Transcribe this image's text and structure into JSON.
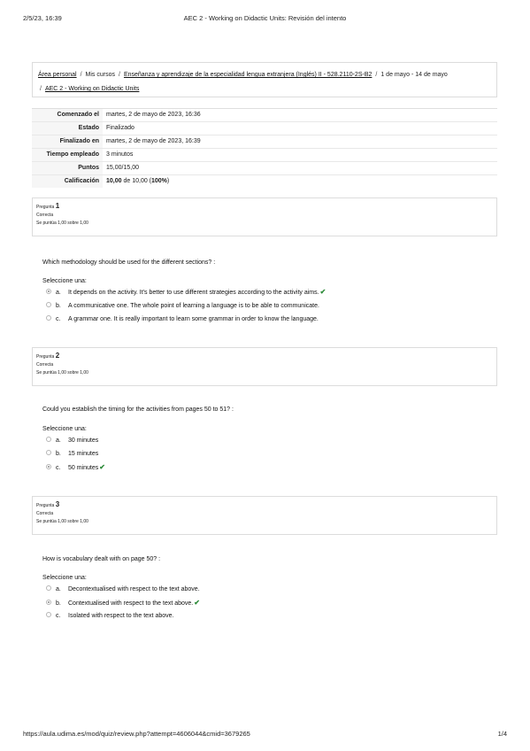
{
  "header": {
    "datetime": "2/5/23, 16:39",
    "title": "AEC 2 - Working on Didactic Units: Revisión del intento"
  },
  "breadcrumb": {
    "items": [
      "Área personal",
      "Mis cursos",
      "Enseñanza y aprendizaje de la especialidad lengua extranjera (Inglés) II - 528.2110-2S-B2",
      "1 de mayo - 14 de mayo",
      "AEC 2 - Working on Didactic Units"
    ],
    "separator": "/"
  },
  "summary": [
    {
      "label": "Comenzado el",
      "value": "martes, 2 de mayo de 2023, 16:36"
    },
    {
      "label": "Estado",
      "value": "Finalizado"
    },
    {
      "label": "Finalizado en",
      "value": "martes, 2 de mayo de 2023, 16:39"
    },
    {
      "label": "Tiempo empleado",
      "value": "3 minutos"
    },
    {
      "label": "Puntos",
      "value": "15,00/15,00"
    },
    {
      "label": "Calificación",
      "value_bold": "10,00",
      "value_mid": " de 10,00 (",
      "value_pct": "100%",
      "value_end": ")"
    }
  ],
  "questions": [
    {
      "prefix": "Pregunta",
      "number": "1",
      "status": "Correcta",
      "score": "Se puntúa 1,00 sobre 1,00",
      "text": "Which methodology should be used for the different sections? :",
      "select_label": "Seleccione una:",
      "options": [
        {
          "letter": "a.",
          "text": "It depends on the activity. It's better to use different strategies according to the activity aims.",
          "selected": true,
          "correct": true
        },
        {
          "letter": "b.",
          "text": "A communicative one. The whole point of learning a language is to be able to communicate.",
          "selected": false,
          "correct": false
        },
        {
          "letter": "c.",
          "text": "A grammar one. It is really important to learn some grammar in order to know the language.",
          "selected": false,
          "correct": false
        }
      ]
    },
    {
      "prefix": "Pregunta",
      "number": "2",
      "status": "Correcta",
      "score": "Se puntúa 1,00 sobre 1,00",
      "text": "Could you establish the timing for the activities from pages 50 to 51? :",
      "select_label": "Seleccione una:",
      "options": [
        {
          "letter": "a.",
          "text": "30 minutes",
          "selected": false,
          "correct": false
        },
        {
          "letter": "b.",
          "text": "15 minutes",
          "selected": false,
          "correct": false
        },
        {
          "letter": "c.",
          "text": "50 minutes",
          "selected": true,
          "correct": true
        }
      ]
    },
    {
      "prefix": "Pregunta",
      "number": "3",
      "status": "Correcta",
      "score": "Se puntúa 1,00 sobre 1,00",
      "text": "How is vocabulary dealt with on page 50? :",
      "select_label": "Seleccione una:",
      "options": [
        {
          "letter": "a.",
          "text": "Decontextualised with respect to the text above.",
          "selected": false,
          "correct": false
        },
        {
          "letter": "b.",
          "text": "Contextualised with respect to the text above.",
          "selected": true,
          "correct": true
        },
        {
          "letter": "c.",
          "text": "Isolated with respect to the text above.",
          "selected": false,
          "correct": false
        }
      ]
    }
  ],
  "check_icon": "check-icon",
  "check_color": "#2e8b3a",
  "footer": {
    "url": "https://aula.udima.es/mod/quiz/review.php?attempt=4606044&cmid=3679265",
    "page": "1/4"
  }
}
